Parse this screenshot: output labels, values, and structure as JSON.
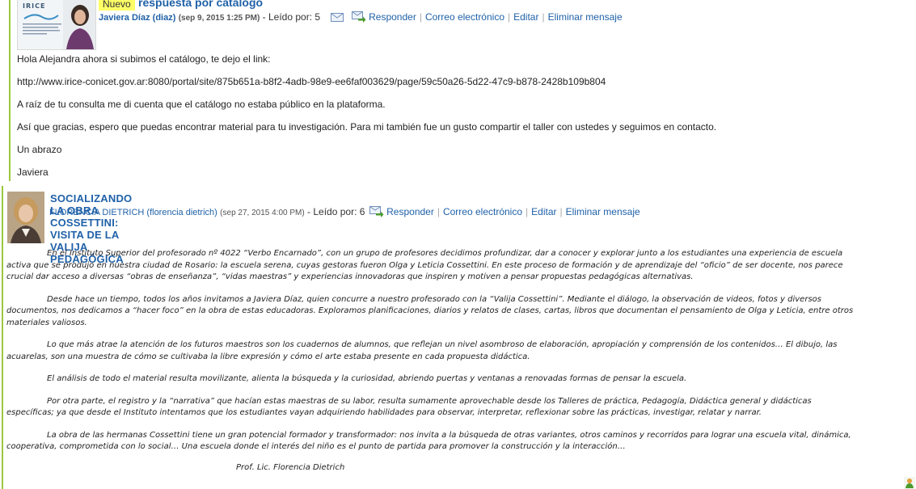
{
  "post1": {
    "badge": "Nuevo",
    "title": "respuesta por catálogo",
    "author": "Javiera Díaz (diaz)",
    "date": "(sep 9, 2015 1:25 PM)",
    "read_by_label": "- Leído por:",
    "read_by_count": "5",
    "actions": {
      "reply": "Responder",
      "email": "Correo electrónico",
      "edit": "Editar",
      "delete": "Eliminar mensaje"
    },
    "avatar": {
      "logo_name": "IRICE",
      "brand_color": "#3c5a78"
    },
    "paragraphs": [
      "Hola Alejandra ahora si subimos el catálogo, te dejo el link:",
      "http://www.irice-conicet.gov.ar:8080/portal/site/875b651a-b8f2-4adb-98e9-ee6faf003629/page/59c50a26-5d22-47c9-b878-2428b109b804",
      "A raíz de tu consulta me di cuenta que el catálogo no estaba público en la plataforma.",
      "Así que gracias, espero que puedas encontrar material para tu investigación. Para mi también fue un gusto compartir el taller con ustedes y seguimos en contacto.",
      "Un abrazo",
      "Javiera"
    ]
  },
  "post2": {
    "title": "SOCIALIZANDO LA OBRA COSSETTINI: VISITA DE LA VALIJA PEDAGÓGICA",
    "author": "FLORENCIA DIETRICH (florencia dietrich)",
    "date": "(sep 27, 2015 4:00 PM)",
    "read_by_label": "- Leído por:",
    "read_by_count": "6",
    "actions": {
      "reply": "Responder",
      "email": "Correo electrónico",
      "edit": "Editar",
      "delete": "Eliminar mensaje"
    },
    "paragraphs": [
      "En el Instituto Superior del profesorado nº 4022 “Verbo Encarnado”, con un grupo de profesores decidimos profundizar, dar a conocer y explorar junto a los estudiantes una experiencia de escuela activa que se produjo en nuestra ciudad de Rosario: la escuela serena, cuyas gestoras fueron Olga y Leticia Cossettini. En este proceso de formación y de aprendizaje del “oficio” de ser docente, nos parece crucial dar acceso a diversas “obras de enseñanza”, “vidas maestras” y experiencias innovadoras que inspiren y motiven a pensar propuestas pedagógicas alternativas.",
      "Desde hace un tiempo, todos los años invitamos a Javiera Díaz, quien concurre a nuestro profesorado con la “Valija Cossettini”. Mediante el diálogo, la observación de videos, fotos y diversos documentos, nos dedicamos a “hacer foco” en la obra de estas educadoras. Exploramos planificaciones, diarios y relatos de clases, cartas, libros que documentan el pensamiento de Olga y Leticia, entre otros materiales valiosos.",
      "Lo que más atrae la atención de los futuros maestros son los cuadernos de alumnos, que reflejan un nivel asombroso de elaboración, apropiación y comprensión de los contenidos… El dibujo, las acuarelas, son una muestra de cómo se cultivaba la libre expresión y cómo el arte estaba presente en cada propuesta didáctica.",
      "El análisis de todo el material resulta movilizante,  alienta la búsqueda y la curiosidad, abriendo  puertas y ventanas a renovadas formas de pensar la escuela.",
      "Por otra parte, el registro y la “narrativa” que hacían estas maestras de su labor, resulta sumamente aprovechable desde los Talleres de práctica, Pedagogía, Didáctica general y didácticas específicas; ya que desde el Instituto intentamos que los estudiantes vayan adquiriendo habilidades para observar, interpretar, reflexionar sobre las prácticas, investigar, relatar y narrar.",
      "La obra de las hermanas Cossettini tiene un gran potencial formador y transformador: nos invita a la búsqueda de otras variantes, otros caminos y recorridos para lograr una escuela vital, dinámica, cooperativa, comprometida con lo social… Una escuela donde el interés del niño es el punto de partida para promover la construcción y la interacción…"
    ],
    "signature": "Prof. Lic. Florencia Dietrich"
  },
  "colors": {
    "link": "#1f61a8",
    "thread_line": "#9bc83e",
    "new_badge": "#ffff66"
  }
}
